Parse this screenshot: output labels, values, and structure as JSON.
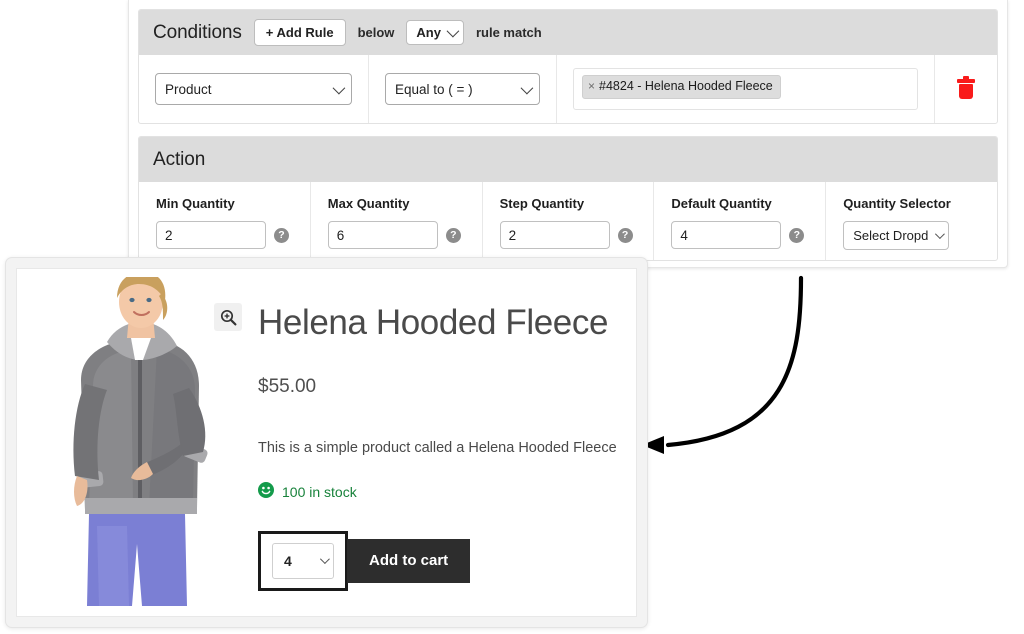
{
  "admin": {
    "conditions": {
      "title": "Conditions",
      "add_rule_label": "+ Add Rule",
      "below_label": "below",
      "match_value": "Any",
      "rule_match_label": "rule match",
      "rows": [
        {
          "field": "Product",
          "operator": "Equal to ( = )",
          "token": "#4824 - Helena Hooded Fleece",
          "token_remove": "×",
          "delete_icon": "trash-icon"
        }
      ]
    },
    "action": {
      "title": "Action",
      "fields": [
        {
          "label": "Min Quantity",
          "value": "2",
          "control": "number",
          "help": "?"
        },
        {
          "label": "Max Quantity",
          "value": "6",
          "control": "number",
          "help": "?"
        },
        {
          "label": "Step Quantity",
          "value": "2",
          "control": "number",
          "help": "?"
        },
        {
          "label": "Default Quantity",
          "value": "4",
          "control": "number",
          "help": "?"
        },
        {
          "label": "Quantity Selector",
          "value": "Select Dropd",
          "control": "select"
        }
      ]
    }
  },
  "product": {
    "zoom_icon": "magnifier-plus-icon",
    "title": "Helena Hooded Fleece",
    "price": "$55.00",
    "description": "This is a simple product called a Helena Hooded Fleece",
    "stock_icon": "smiley-face-icon",
    "stock_text": "100 in stock",
    "quantity_value": "4",
    "add_to_cart_label": "Add to cart"
  },
  "annotation": {
    "arrow": "curved-arrow-pointing-left"
  },
  "colors": {
    "header_grey": "#dcdcdc",
    "delete_red": "#f91b1b",
    "stock_green": "#18823b",
    "button_dark": "#2d2d2d",
    "highlight_outline": "#1a1a1a"
  }
}
